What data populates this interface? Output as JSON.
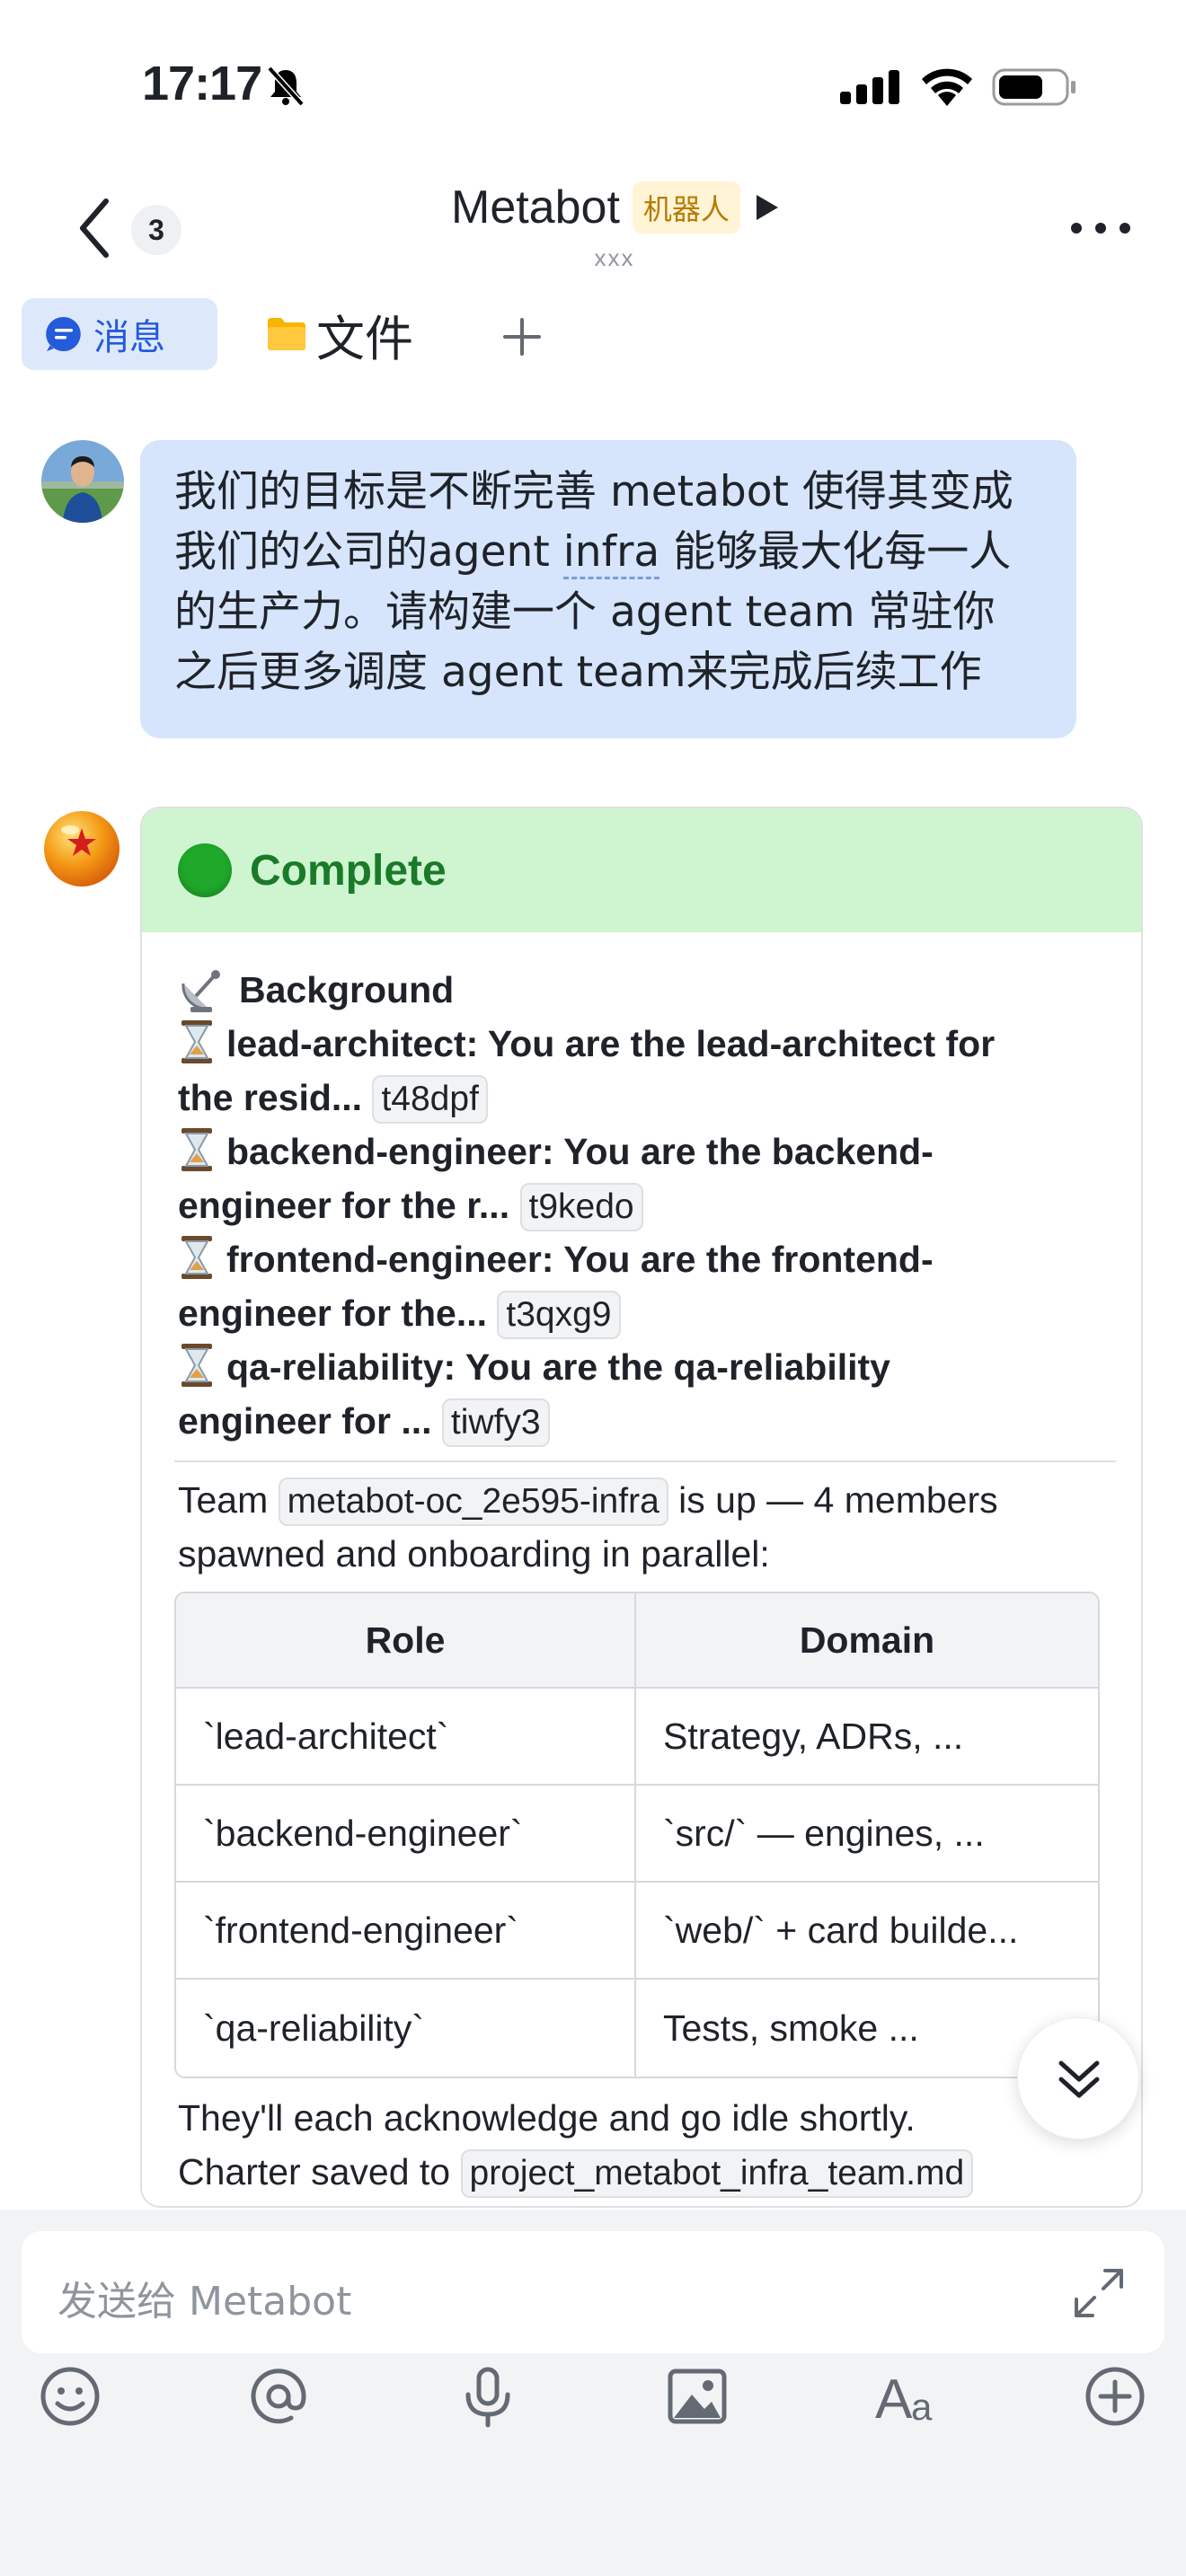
{
  "status_bar": {
    "time": "17:17"
  },
  "header": {
    "unread_count": "3",
    "title": "Metabot",
    "bot_tag": "机器人",
    "subtitle": "xxx"
  },
  "tabs": [
    {
      "label": "消息",
      "active": true
    },
    {
      "label": "文件",
      "active": false
    }
  ],
  "user_message": {
    "lines": [
      "我们的目标是不断完善 metabot 使得其变成",
      "我们的公司的agent ",
      "infra",
      " 能够最大化每一人",
      "的生产力。请构建一个 agent team 常驻你",
      "之后更多调度 agent team来完成后续工作"
    ]
  },
  "bot_card": {
    "status": "Complete",
    "status_color": "#1fa82a",
    "background_label": "Background",
    "agents": [
      {
        "text_1": "lead-architect: You are the lead-architect for",
        "text_2": "the resid...",
        "id": "t48dpf"
      },
      {
        "text_1": "backend-engineer: You are the backend-",
        "text_2": "engineer for the r...",
        "id": "t9kedo"
      },
      {
        "text_1": "frontend-engineer: You are the frontend-",
        "text_2": "engineer for the...",
        "id": "t3qxg9"
      },
      {
        "text_1": "qa-reliability: You are the qa-reliability",
        "text_2": "engineer for ...",
        "id": "tiwfy3"
      }
    ],
    "team_prefix": "Team",
    "team_name": "metabot-oc_2e595-infra",
    "team_suffix": "is up — 4 members",
    "team_line2": "spawned and onboarding in parallel:",
    "table": {
      "headers": [
        "Role",
        "Domain"
      ],
      "rows": [
        [
          "`lead-architect`",
          "Strategy, ADRs, ..."
        ],
        [
          "`backend-engineer`",
          "`src/` — engines, ..."
        ],
        [
          "`frontend-engineer`",
          "`web/` + card builde..."
        ],
        [
          "`qa-reliability`",
          "Tests, smoke ..."
        ]
      ]
    },
    "footer_line1": "They'll each acknowledge and go idle shortly.",
    "footer_prefix": "Charter saved to",
    "charter_file": "project_metabot_infra_team.md"
  },
  "composer": {
    "placeholder": "发送给 Metabot"
  },
  "toolbar": [
    "emoji-icon",
    "mention-icon",
    "voice-icon",
    "image-icon",
    "text-format-icon",
    "more-add-icon"
  ]
}
